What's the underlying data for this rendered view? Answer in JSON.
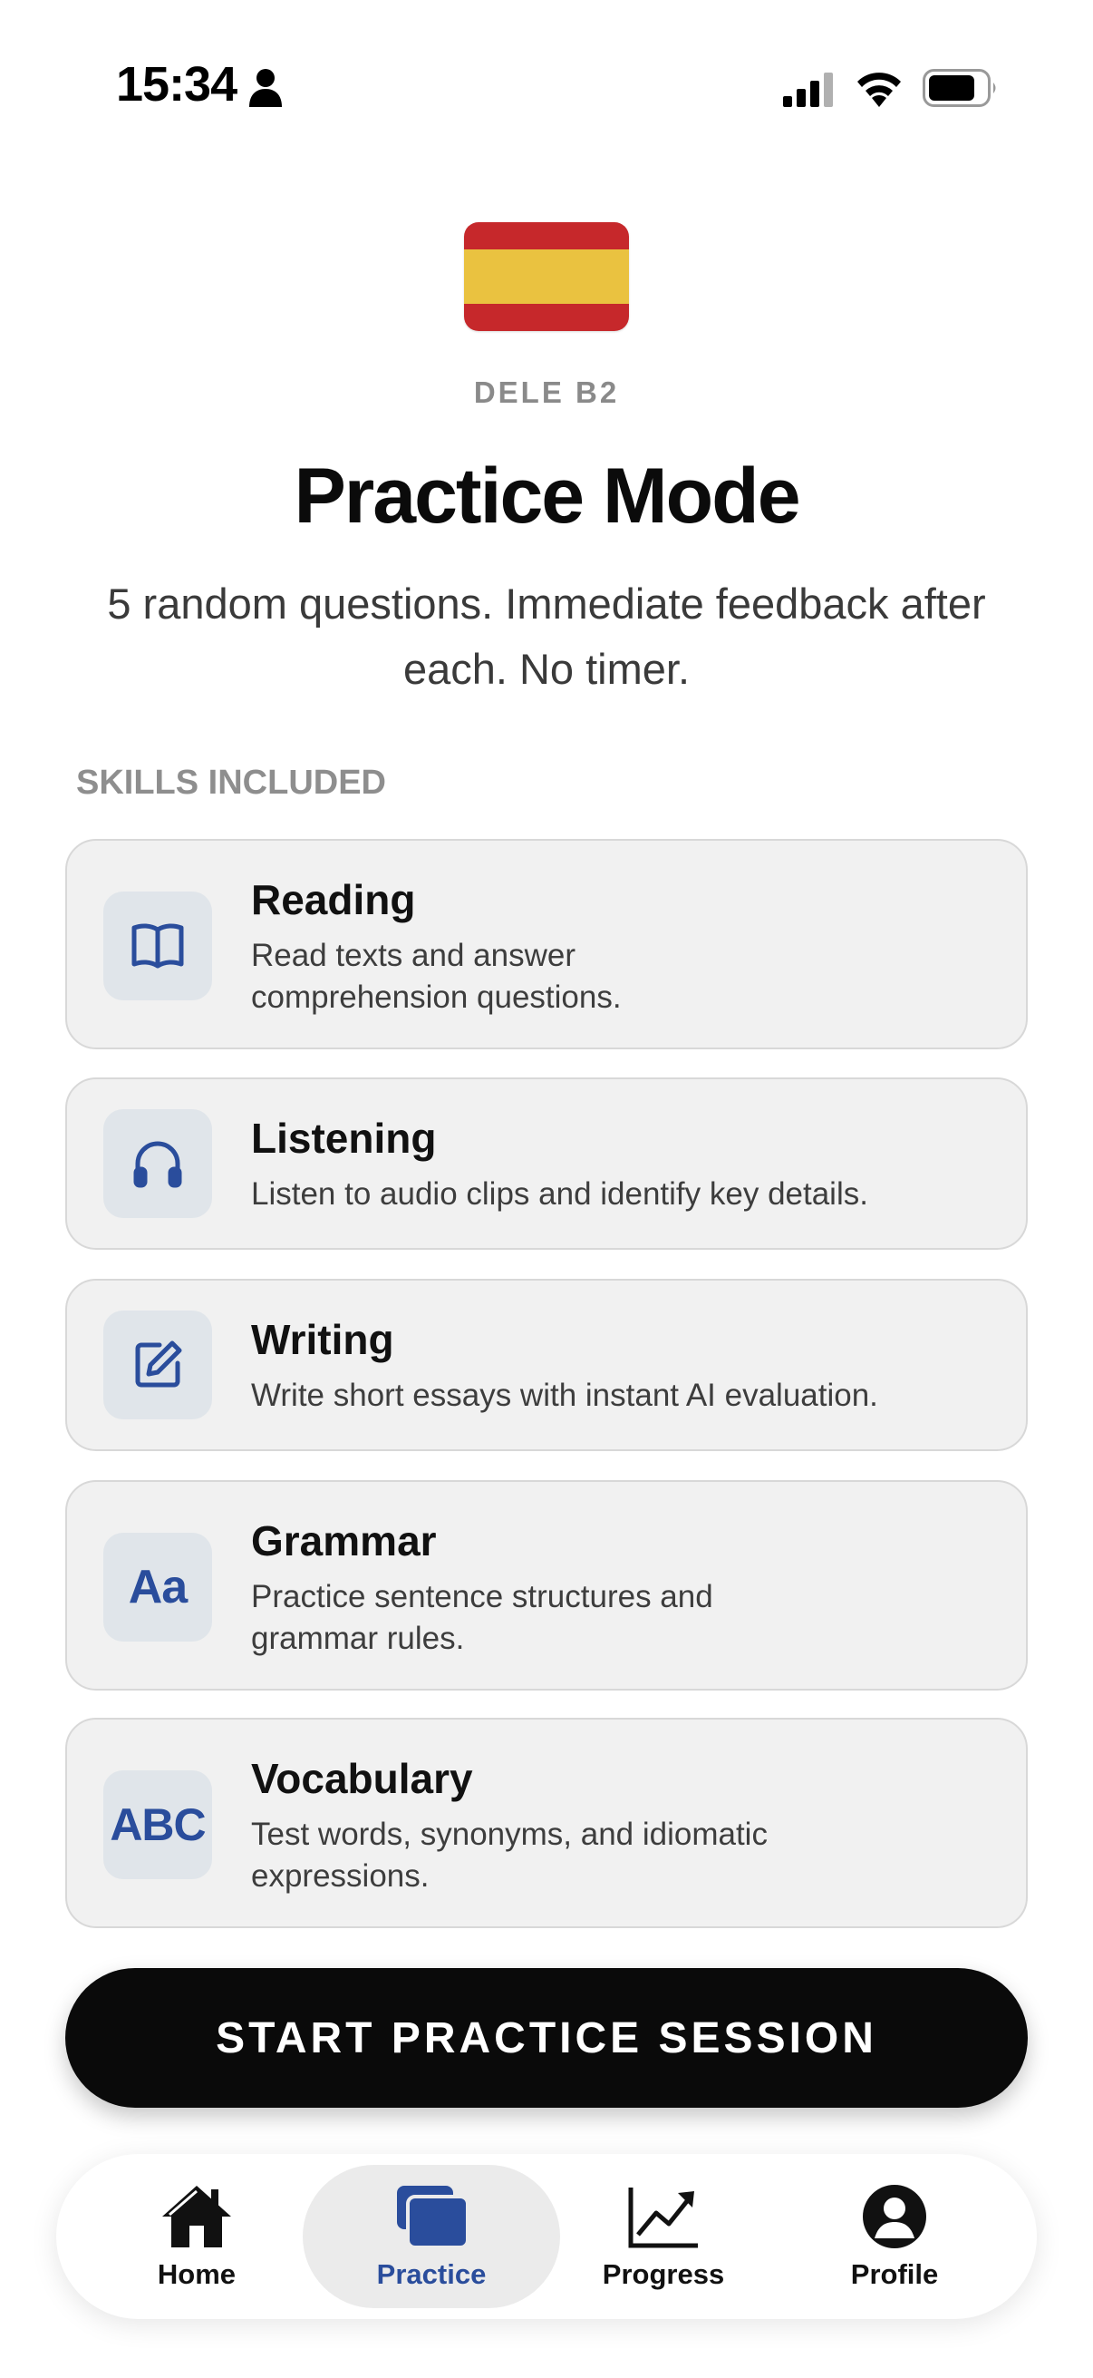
{
  "status_bar": {
    "time": "15:34"
  },
  "header": {
    "exam_label": "DELE B2",
    "title": "Practice Mode",
    "subtitle": "5 random questions. Immediate feedback after each. No timer.",
    "flag_colors": [
      "#c6282b",
      "#eac240",
      "#c6282b"
    ]
  },
  "skills": {
    "section_label": "SKILLS INCLUDED",
    "items": [
      {
        "title": "Reading",
        "description": "Read texts and answer comprehension questions.",
        "icon": "book-icon"
      },
      {
        "title": "Listening",
        "description": "Listen to audio clips and identify key details.",
        "icon": "headphones-icon"
      },
      {
        "title": "Writing",
        "description": "Write short essays with instant AI evaluation.",
        "icon": "edit-icon"
      },
      {
        "title": "Grammar",
        "description": "Practice sentence structures and grammar rules.",
        "icon": "aa-icon",
        "icon_text": "Aa"
      },
      {
        "title": "Vocabulary",
        "description": "Test words, synonyms, and idiomatic expressions.",
        "icon": "abc-icon",
        "icon_text": "ABC"
      }
    ]
  },
  "cta": {
    "label": "START PRACTICE SESSION"
  },
  "bottom_nav": {
    "active": "Practice",
    "accent_color": "#2a4d9c",
    "items": [
      {
        "label": "Home",
        "icon": "home-icon"
      },
      {
        "label": "Practice",
        "icon": "cards-icon"
      },
      {
        "label": "Progress",
        "icon": "chart-icon"
      },
      {
        "label": "Profile",
        "icon": "profile-icon"
      }
    ]
  }
}
